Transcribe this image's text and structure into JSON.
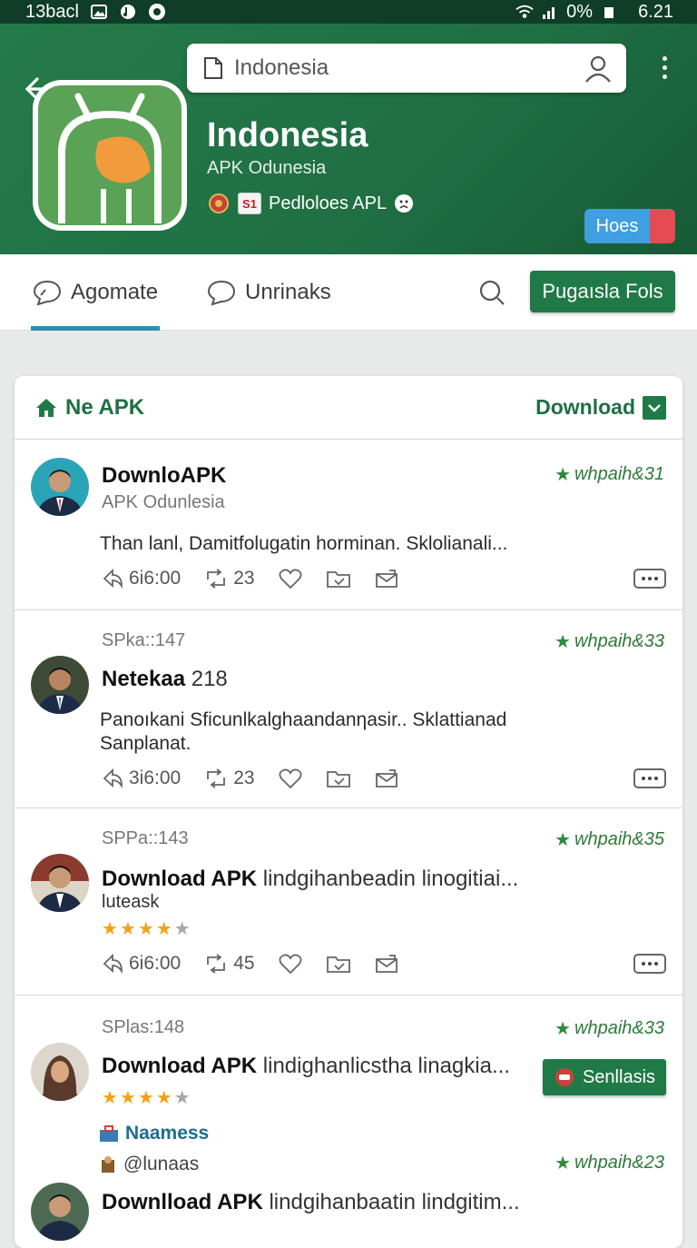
{
  "status_bar": {
    "left_text": "13bacl",
    "battery_text": "0%",
    "time": "6.21"
  },
  "header": {
    "search_query": "Indonesia",
    "app_title": "Indonesia",
    "app_subtitle": "APK Odunesia",
    "badge_text": "S1",
    "meta_label": "Pedloloes APL",
    "hoes_button": "Hoes"
  },
  "tabs": [
    {
      "label": "Agomate",
      "icon": "chat-bubble-icon",
      "active": true
    },
    {
      "label": "Unrinaks",
      "icon": "comment-icon",
      "active": false
    }
  ],
  "primary_button": "Pugaısla Fols",
  "feed": {
    "title": "Ne APK",
    "download_label": "Download",
    "posts": [
      {
        "name": "DownloAPK",
        "name_suffix": "",
        "subtitle": "APK Odunlesia",
        "tag": "whpaih&31",
        "text": "Than lanl, Damitfolugatin horminan. Sklolianali...",
        "comments": "6i6:00",
        "shares": "23"
      },
      {
        "time": "SPka::147",
        "name": "Netekaa",
        "name_suffix": "218",
        "tag": "whpaih&33",
        "text": "Panoıkani Sficunlkalghaandanηasir.. Sklattianad Sanplanat.",
        "comments": "3i6:00",
        "shares": "23"
      },
      {
        "time": "SPPa::143",
        "name": "Download APK",
        "name_suffix": "lindgihanbeadin linogitiai...",
        "handle": "luteask",
        "rating": 4,
        "tag": "whpaih&35",
        "comments": "6i6:00",
        "shares": "45"
      },
      {
        "time": "SPlas:148",
        "name": "Download APK",
        "name_suffix": "lindighanlicstha linagkia...",
        "rating": 4,
        "tag": "whpaih&33",
        "send_button": "Senllasis",
        "category": "Naamess",
        "handle": "@lunaas",
        "tag2": "whpaih&23"
      },
      {
        "name": "Downlload APK",
        "name_suffix": "lindgihanbaatin lindgitim..."
      }
    ]
  },
  "colors": {
    "brand_green": "#1f7a47",
    "header_green": "#257a4a",
    "accent_blue": "#2b8fb4",
    "star": "#f2a21a"
  }
}
